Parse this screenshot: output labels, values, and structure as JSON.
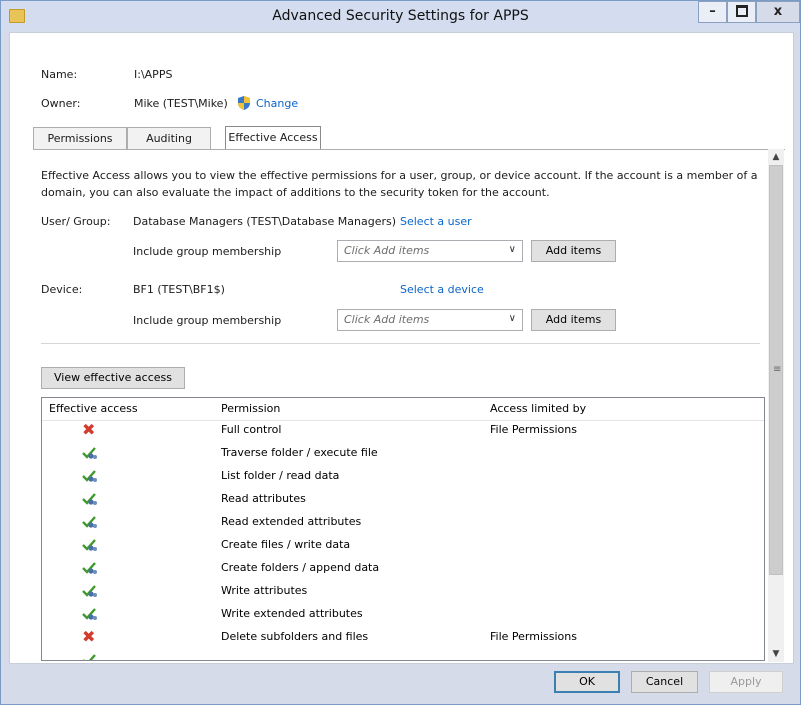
{
  "window": {
    "title": "Advanced Security Settings for APPS"
  },
  "header": {
    "name_label": "Name:",
    "name_value": "I:\\APPS",
    "owner_label": "Owner:",
    "owner_value": "Mike (TEST\\Mike)",
    "change_link": "Change"
  },
  "tabs": [
    {
      "label": "Permissions"
    },
    {
      "label": "Auditing"
    },
    {
      "label": "Effective Access",
      "active": true
    }
  ],
  "effective": {
    "description_line1": "Effective Access allows you to view the effective permissions for a user, group, or device account. If the account is a member of a",
    "description_line2": "domain, you can also evaluate the impact of additions to the security token for the account.",
    "user_label": "User/ Group:",
    "user_value": "Database Managers (TEST\\Database Managers)",
    "select_user": "Select a user",
    "include_label": "Include group membership",
    "combo_placeholder": "Click Add items",
    "add_items": "Add items",
    "device_label": "Device:",
    "device_value": "BF1 (TEST\\BF1$)",
    "select_device": "Select a device",
    "view_button": "View effective access"
  },
  "table": {
    "columns": [
      "Effective access",
      "Permission",
      "Access limited by"
    ],
    "rows": [
      {
        "status": "denied",
        "permission": "Full control",
        "limited_by": "File Permissions"
      },
      {
        "status": "allowed",
        "permission": "Traverse folder / execute file",
        "limited_by": ""
      },
      {
        "status": "allowed",
        "permission": "List folder / read data",
        "limited_by": ""
      },
      {
        "status": "allowed",
        "permission": "Read attributes",
        "limited_by": ""
      },
      {
        "status": "allowed",
        "permission": "Read extended attributes",
        "limited_by": ""
      },
      {
        "status": "allowed",
        "permission": "Create files / write data",
        "limited_by": ""
      },
      {
        "status": "allowed",
        "permission": "Create folders / append data",
        "limited_by": ""
      },
      {
        "status": "allowed",
        "permission": "Write attributes",
        "limited_by": ""
      },
      {
        "status": "allowed",
        "permission": "Write extended attributes",
        "limited_by": ""
      },
      {
        "status": "denied",
        "permission": "Delete subfolders and files",
        "limited_by": "File Permissions"
      },
      {
        "status": "allowed",
        "permission": "",
        "limited_by": ""
      }
    ]
  },
  "footer": {
    "ok": "OK",
    "cancel": "Cancel",
    "apply": "Apply"
  },
  "colors": {
    "link": "#0b66c9",
    "denied": "#d43b2f",
    "allowed": "#3f9a2c"
  }
}
